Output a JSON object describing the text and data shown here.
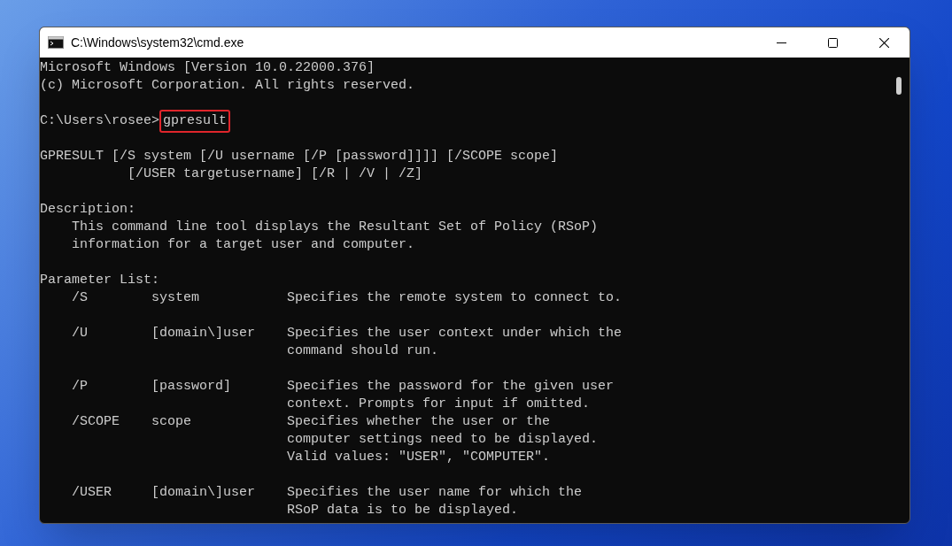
{
  "window": {
    "title": "C:\\Windows\\system32\\cmd.exe"
  },
  "console": {
    "lines": [
      {
        "kind": "text",
        "text": "Microsoft Windows [Version 10.0.22000.376]"
      },
      {
        "kind": "text",
        "text": "(c) Microsoft Corporation. All rights reserved."
      },
      {
        "kind": "blank"
      },
      {
        "kind": "prompt",
        "prompt": "C:\\Users\\rosee>",
        "command": "gpresult",
        "highlighted": true
      },
      {
        "kind": "blank"
      },
      {
        "kind": "text",
        "text": "GPRESULT [/S system [/U username [/P [password]]]] [/SCOPE scope]"
      },
      {
        "kind": "text",
        "text": "           [/USER targetusername] [/R | /V | /Z]"
      },
      {
        "kind": "blank"
      },
      {
        "kind": "text",
        "text": "Description:"
      },
      {
        "kind": "text",
        "text": "    This command line tool displays the Resultant Set of Policy (RSoP)"
      },
      {
        "kind": "text",
        "text": "    information for a target user and computer."
      },
      {
        "kind": "blank"
      },
      {
        "kind": "text",
        "text": "Parameter List:"
      },
      {
        "kind": "text",
        "text": "    /S        system           Specifies the remote system to connect to."
      },
      {
        "kind": "blank"
      },
      {
        "kind": "text",
        "text": "    /U        [domain\\]user    Specifies the user context under which the"
      },
      {
        "kind": "text",
        "text": "                               command should run."
      },
      {
        "kind": "blank"
      },
      {
        "kind": "text",
        "text": "    /P        [password]       Specifies the password for the given user"
      },
      {
        "kind": "text",
        "text": "                               context. Prompts for input if omitted."
      },
      {
        "kind": "text",
        "text": "    /SCOPE    scope            Specifies whether the user or the"
      },
      {
        "kind": "text",
        "text": "                               computer settings need to be displayed."
      },
      {
        "kind": "text",
        "text": "                               Valid values: \"USER\", \"COMPUTER\"."
      },
      {
        "kind": "blank"
      },
      {
        "kind": "text",
        "text": "    /USER     [domain\\]user    Specifies the user name for which the"
      },
      {
        "kind": "text",
        "text": "                               RSoP data is to be displayed."
      }
    ]
  }
}
